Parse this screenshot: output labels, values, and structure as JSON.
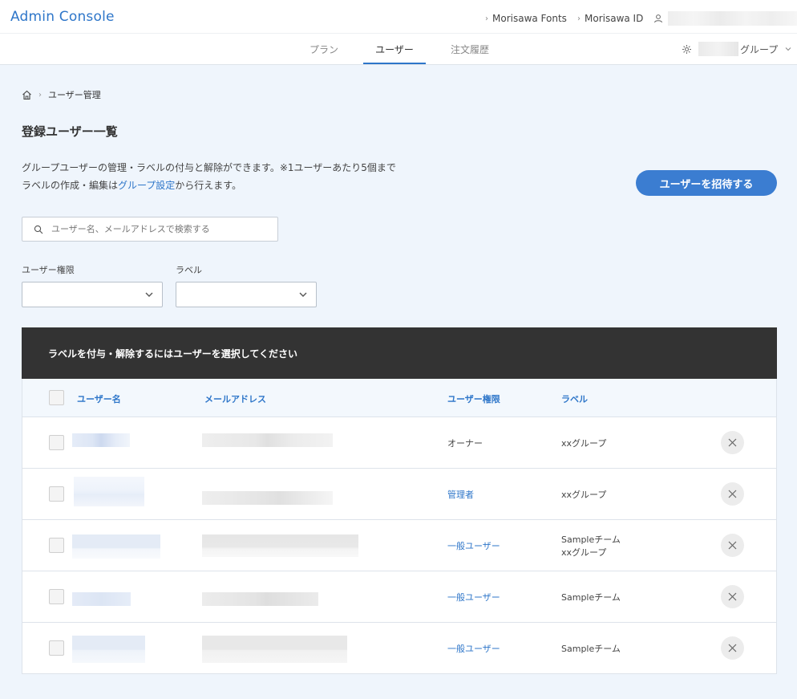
{
  "header": {
    "app_title": "Admin Console",
    "links": [
      {
        "label": "Morisawa Fonts"
      },
      {
        "label": "Morisawa ID"
      }
    ],
    "group_suffix": "グループ"
  },
  "tabs": [
    {
      "label": "プラン",
      "active": false
    },
    {
      "label": "ユーザー",
      "active": true
    },
    {
      "label": "注文履歴",
      "active": false
    }
  ],
  "breadcrumb": {
    "current": "ユーザー管理"
  },
  "page": {
    "title": "登録ユーザー一覧",
    "desc_line1": "グループユーザーの管理・ラベルの付与と解除ができます。※1ユーザーあたり5個まで",
    "desc_line2_pre": "ラベルの作成・編集は",
    "desc_line2_link": "グループ設定",
    "desc_line2_post": "から行えます。",
    "invite_label": "ユーザーを招待する"
  },
  "search": {
    "placeholder": "ユーザー名、メールアドレスで検索する"
  },
  "filters": {
    "role_label": "ユーザー権限",
    "label_label": "ラベル"
  },
  "banner": {
    "text": "ラベルを付与・解除するにはユーザーを選択してください"
  },
  "table": {
    "columns": [
      "ユーザー名",
      "メールアドレス",
      "ユーザー権限",
      "ラベル"
    ],
    "rows": [
      {
        "role": "オーナー",
        "role_link": false,
        "labels": [
          "xxグループ"
        ]
      },
      {
        "role": "管理者",
        "role_link": true,
        "labels": [
          "xxグループ"
        ]
      },
      {
        "role": "一般ユーザー",
        "role_link": true,
        "labels": [
          "Sampleチーム",
          "xxグループ"
        ]
      },
      {
        "role": "一般ユーザー",
        "role_link": true,
        "labels": [
          "Sampleチーム"
        ]
      },
      {
        "role": "一般ユーザー",
        "role_link": true,
        "labels": [
          "Sampleチーム"
        ]
      }
    ]
  },
  "colors": {
    "accent": "#2e76c9",
    "banner_bg": "#333333",
    "page_bg": "#eff5fc"
  }
}
